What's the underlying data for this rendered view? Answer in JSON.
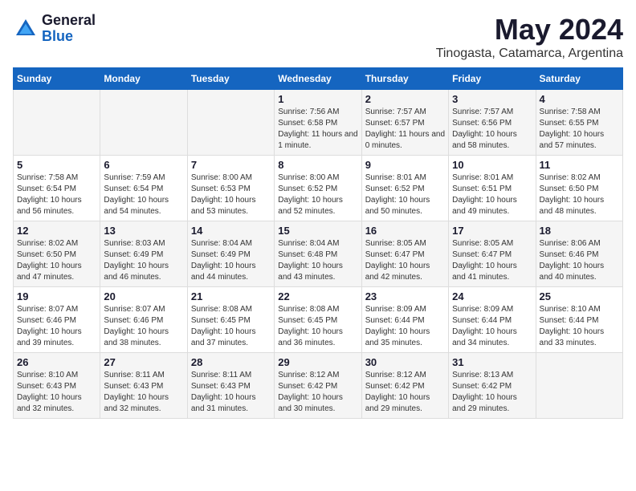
{
  "logo": {
    "general": "General",
    "blue": "Blue"
  },
  "title": "May 2024",
  "subtitle": "Tinogasta, Catamarca, Argentina",
  "days_of_week": [
    "Sunday",
    "Monday",
    "Tuesday",
    "Wednesday",
    "Thursday",
    "Friday",
    "Saturday"
  ],
  "weeks": [
    [
      {
        "day": "",
        "sunrise": "",
        "sunset": "",
        "daylight": "",
        "empty": true
      },
      {
        "day": "",
        "sunrise": "",
        "sunset": "",
        "daylight": "",
        "empty": true
      },
      {
        "day": "",
        "sunrise": "",
        "sunset": "",
        "daylight": "",
        "empty": true
      },
      {
        "day": "1",
        "sunrise": "Sunrise: 7:56 AM",
        "sunset": "Sunset: 6:58 PM",
        "daylight": "Daylight: 11 hours and 1 minute."
      },
      {
        "day": "2",
        "sunrise": "Sunrise: 7:57 AM",
        "sunset": "Sunset: 6:57 PM",
        "daylight": "Daylight: 11 hours and 0 minutes."
      },
      {
        "day": "3",
        "sunrise": "Sunrise: 7:57 AM",
        "sunset": "Sunset: 6:56 PM",
        "daylight": "Daylight: 10 hours and 58 minutes."
      },
      {
        "day": "4",
        "sunrise": "Sunrise: 7:58 AM",
        "sunset": "Sunset: 6:55 PM",
        "daylight": "Daylight: 10 hours and 57 minutes."
      }
    ],
    [
      {
        "day": "5",
        "sunrise": "Sunrise: 7:58 AM",
        "sunset": "Sunset: 6:54 PM",
        "daylight": "Daylight: 10 hours and 56 minutes."
      },
      {
        "day": "6",
        "sunrise": "Sunrise: 7:59 AM",
        "sunset": "Sunset: 6:54 PM",
        "daylight": "Daylight: 10 hours and 54 minutes."
      },
      {
        "day": "7",
        "sunrise": "Sunrise: 8:00 AM",
        "sunset": "Sunset: 6:53 PM",
        "daylight": "Daylight: 10 hours and 53 minutes."
      },
      {
        "day": "8",
        "sunrise": "Sunrise: 8:00 AM",
        "sunset": "Sunset: 6:52 PM",
        "daylight": "Daylight: 10 hours and 52 minutes."
      },
      {
        "day": "9",
        "sunrise": "Sunrise: 8:01 AM",
        "sunset": "Sunset: 6:52 PM",
        "daylight": "Daylight: 10 hours and 50 minutes."
      },
      {
        "day": "10",
        "sunrise": "Sunrise: 8:01 AM",
        "sunset": "Sunset: 6:51 PM",
        "daylight": "Daylight: 10 hours and 49 minutes."
      },
      {
        "day": "11",
        "sunrise": "Sunrise: 8:02 AM",
        "sunset": "Sunset: 6:50 PM",
        "daylight": "Daylight: 10 hours and 48 minutes."
      }
    ],
    [
      {
        "day": "12",
        "sunrise": "Sunrise: 8:02 AM",
        "sunset": "Sunset: 6:50 PM",
        "daylight": "Daylight: 10 hours and 47 minutes."
      },
      {
        "day": "13",
        "sunrise": "Sunrise: 8:03 AM",
        "sunset": "Sunset: 6:49 PM",
        "daylight": "Daylight: 10 hours and 46 minutes."
      },
      {
        "day": "14",
        "sunrise": "Sunrise: 8:04 AM",
        "sunset": "Sunset: 6:49 PM",
        "daylight": "Daylight: 10 hours and 44 minutes."
      },
      {
        "day": "15",
        "sunrise": "Sunrise: 8:04 AM",
        "sunset": "Sunset: 6:48 PM",
        "daylight": "Daylight: 10 hours and 43 minutes."
      },
      {
        "day": "16",
        "sunrise": "Sunrise: 8:05 AM",
        "sunset": "Sunset: 6:47 PM",
        "daylight": "Daylight: 10 hours and 42 minutes."
      },
      {
        "day": "17",
        "sunrise": "Sunrise: 8:05 AM",
        "sunset": "Sunset: 6:47 PM",
        "daylight": "Daylight: 10 hours and 41 minutes."
      },
      {
        "day": "18",
        "sunrise": "Sunrise: 8:06 AM",
        "sunset": "Sunset: 6:46 PM",
        "daylight": "Daylight: 10 hours and 40 minutes."
      }
    ],
    [
      {
        "day": "19",
        "sunrise": "Sunrise: 8:07 AM",
        "sunset": "Sunset: 6:46 PM",
        "daylight": "Daylight: 10 hours and 39 minutes."
      },
      {
        "day": "20",
        "sunrise": "Sunrise: 8:07 AM",
        "sunset": "Sunset: 6:46 PM",
        "daylight": "Daylight: 10 hours and 38 minutes."
      },
      {
        "day": "21",
        "sunrise": "Sunrise: 8:08 AM",
        "sunset": "Sunset: 6:45 PM",
        "daylight": "Daylight: 10 hours and 37 minutes."
      },
      {
        "day": "22",
        "sunrise": "Sunrise: 8:08 AM",
        "sunset": "Sunset: 6:45 PM",
        "daylight": "Daylight: 10 hours and 36 minutes."
      },
      {
        "day": "23",
        "sunrise": "Sunrise: 8:09 AM",
        "sunset": "Sunset: 6:44 PM",
        "daylight": "Daylight: 10 hours and 35 minutes."
      },
      {
        "day": "24",
        "sunrise": "Sunrise: 8:09 AM",
        "sunset": "Sunset: 6:44 PM",
        "daylight": "Daylight: 10 hours and 34 minutes."
      },
      {
        "day": "25",
        "sunrise": "Sunrise: 8:10 AM",
        "sunset": "Sunset: 6:44 PM",
        "daylight": "Daylight: 10 hours and 33 minutes."
      }
    ],
    [
      {
        "day": "26",
        "sunrise": "Sunrise: 8:10 AM",
        "sunset": "Sunset: 6:43 PM",
        "daylight": "Daylight: 10 hours and 32 minutes."
      },
      {
        "day": "27",
        "sunrise": "Sunrise: 8:11 AM",
        "sunset": "Sunset: 6:43 PM",
        "daylight": "Daylight: 10 hours and 32 minutes."
      },
      {
        "day": "28",
        "sunrise": "Sunrise: 8:11 AM",
        "sunset": "Sunset: 6:43 PM",
        "daylight": "Daylight: 10 hours and 31 minutes."
      },
      {
        "day": "29",
        "sunrise": "Sunrise: 8:12 AM",
        "sunset": "Sunset: 6:42 PM",
        "daylight": "Daylight: 10 hours and 30 minutes."
      },
      {
        "day": "30",
        "sunrise": "Sunrise: 8:12 AM",
        "sunset": "Sunset: 6:42 PM",
        "daylight": "Daylight: 10 hours and 29 minutes."
      },
      {
        "day": "31",
        "sunrise": "Sunrise: 8:13 AM",
        "sunset": "Sunset: 6:42 PM",
        "daylight": "Daylight: 10 hours and 29 minutes."
      },
      {
        "day": "",
        "sunrise": "",
        "sunset": "",
        "daylight": "",
        "empty": true
      }
    ]
  ]
}
